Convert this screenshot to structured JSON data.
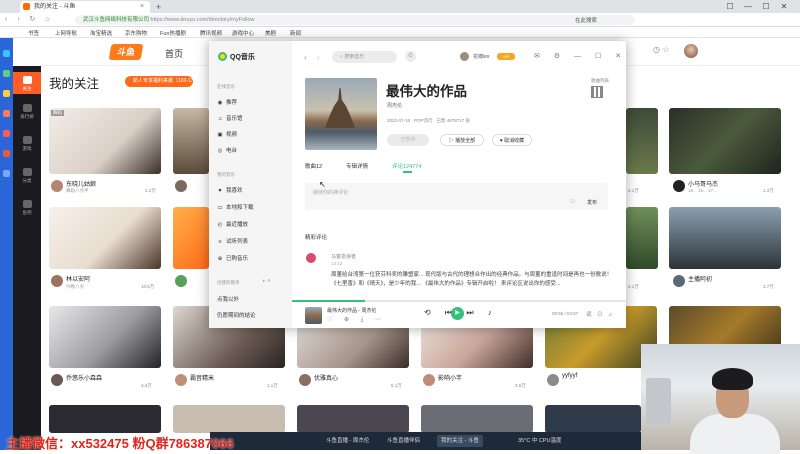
{
  "browser": {
    "tab_title": "我的关注 - 斗鱼",
    "tab_close": "×",
    "new_tab": "+",
    "window_controls": [
      "☐",
      "—",
      "☐",
      "✕"
    ],
    "nav_icons": "‹ › ↻ ⌂",
    "cert": "武汉斗鱼网络科技有限公司",
    "url": "https://www.douyu.com/directory/myFollow",
    "search_hint": "在此搜索"
  },
  "bookmarks": [
    "书签",
    "上网导航",
    "淘宝精选",
    "京东购物",
    "Fun热播剧",
    "腾讯视频",
    "游戏中心",
    "美剧",
    "新闻"
  ],
  "douyu": {
    "logo": "斗鱼",
    "nav_home": "首页",
    "page_title": "我的关注",
    "banner": "新人专享福利来袭（100-1）",
    "sidebar": [
      {
        "label": "关注",
        "active": true
      },
      {
        "label": "排行榜",
        "active": false
      },
      {
        "label": "游戏",
        "active": false
      },
      {
        "label": "分类",
        "active": false
      },
      {
        "label": "鱼吧",
        "active": false
      }
    ]
  },
  "cards": [
    {
      "name": "东晓儿姑娘",
      "sub": "舞蹈八点半",
      "heat": "1.2万",
      "tag": "舞蹈"
    },
    {
      "name": "",
      "sub": "",
      "heat": "",
      "tag": ""
    },
    {
      "name": "小马哥搞笑",
      "sub": "",
      "heat": "2.1万",
      "tag": ""
    },
    {
      "name": "",
      "sub": "",
      "heat": "",
      "tag": ""
    },
    {
      "name": "小马哥马杰",
      "sub": "15... 16... 17...",
      "heat": "1.3万",
      "tag": ""
    },
    {
      "name": "林以安阿",
      "sub": "今晚八点",
      "heat": "10.5万",
      "tag": ""
    },
    {
      "name": "",
      "sub": "",
      "heat": "",
      "tag": ""
    },
    {
      "name": "",
      "sub": "",
      "heat": "",
      "tag": ""
    },
    {
      "name": "",
      "sub": "",
      "heat": "2.1万",
      "tag": ""
    },
    {
      "name": "主播阿初",
      "sub": "",
      "heat": "3.7万",
      "tag": ""
    },
    {
      "name": "乔悠乐小森森",
      "sub": "",
      "heat": "3.3万",
      "tag": ""
    },
    {
      "name": "霸音精米",
      "sub": "",
      "heat": "1.1万",
      "tag": ""
    },
    {
      "name": "优雅真心",
      "sub": "",
      "heat": "5.1万",
      "tag": ""
    },
    {
      "name": "影响小芊",
      "sub": "",
      "heat": "3.5万",
      "tag": ""
    },
    {
      "name": "yyfyyf",
      "sub": "",
      "heat": "",
      "tag": ""
    }
  ],
  "qqmusic": {
    "app_name": "QQ音乐",
    "sections": [
      {
        "title": "在线音乐",
        "items": [
          [
            "◉",
            "推荐"
          ],
          [
            "♫",
            "音乐馆"
          ],
          [
            "▣",
            "视频"
          ],
          [
            "◎",
            "电台"
          ]
        ]
      },
      {
        "title": "我的音乐",
        "items": [
          [
            "♥",
            "我喜欢"
          ],
          [
            "▭",
            "本地和下载"
          ],
          [
            "◴",
            "最近播放"
          ],
          [
            "≡",
            "试听列表"
          ],
          [
            "⊕",
            "已购音乐"
          ]
        ]
      },
      {
        "title": "创建的歌单",
        "items": [
          [
            "",
            "点我以外"
          ],
          [
            "",
            "仍愿期间的结论"
          ]
        ]
      }
    ],
    "search_placeholder": "搜索音乐",
    "mic": "⊙",
    "username": "花椒lex",
    "vip": "VIP",
    "window_buttons": "✉ ⚙ — ☐ ✕",
    "right_button": "歌曲列表",
    "album": {
      "title": "最伟大的作品",
      "singer": "周杰伦",
      "meta": "2022-07-15 · POP流行 · 已售 4878717 张",
      "play": "已暂停",
      "play_all": "▷ 播放全部",
      "fav": "♥ 取消收藏",
      "tabs": [
        "歌曲12",
        "专辑详情",
        "评论124774"
      ]
    },
    "comment_placeholder": "期待你的神评论",
    "emoji": "☺",
    "send": "发布",
    "hot_title": "精彩评论",
    "comment": {
      "user": "马客逐浪者",
      "time": "13:12",
      "text": "周董给台湾第一位获芬科奖的雕塑家... 现代版与古代的理想合作出的经典作品。与周董的重逢时间是再也一份歌说！ 《七里香》和《晴天》，是少年的我... 《最伟大的作品》专辑开启啦！ 来评论区说出你的感受..."
    },
    "player": {
      "song": "最伟大的作品 - 周杰伦",
      "actions": "♡ ⊕ ⤓ ⋯",
      "controls": "⟲ ⏮ ⏭ ♪",
      "play_icon": "▶",
      "progress": 0.22,
      "time": "00:55 / 04:07",
      "right": "词 ⊙ ♫"
    }
  },
  "overlay_text": "主播微信：xx532475 粉Q群786387066",
  "taskbar": {
    "tasks": [
      "斗鱼直播 - 周杰伦",
      "斗鱼直播伴侣",
      "我的关注 - 斗鱼"
    ],
    "tray": "35°C  中  CPU温度"
  },
  "colors": {
    "douyu_orange": "#ff6a1a",
    "qq_green": "#31c27c",
    "overlay_red": "#e1251b"
  }
}
